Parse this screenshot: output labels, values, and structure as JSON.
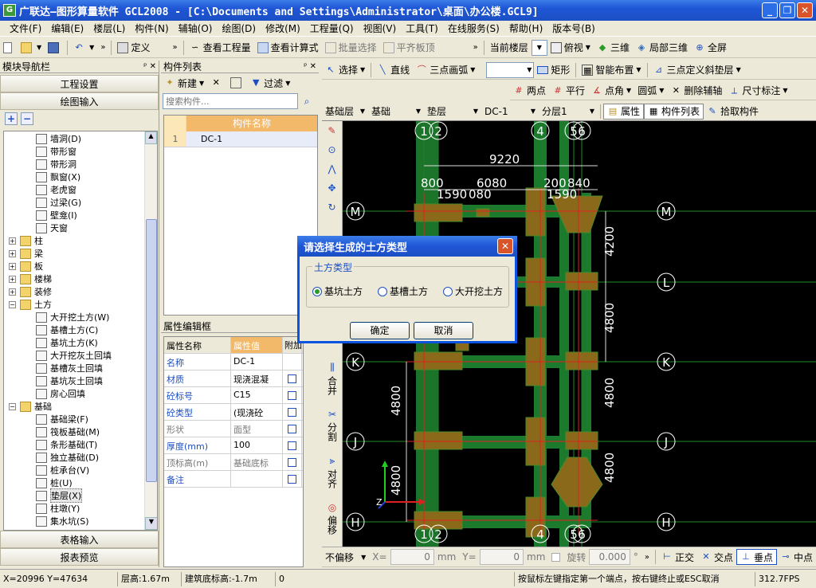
{
  "window": {
    "title": "广联达—图形算量软件 GCL2008 - [C:\\Documents and Settings\\Administrator\\桌面\\办公楼.GCL9]"
  },
  "menu": [
    "文件(F)",
    "编辑(E)",
    "楼层(L)",
    "构件(N)",
    "辅轴(O)",
    "绘图(D)",
    "修改(M)",
    "工程量(Q)",
    "视图(V)",
    "工具(T)",
    "在线服务(S)",
    "帮助(H)",
    "版本号(B)"
  ],
  "toolbar1": {
    "define": "定义",
    "view_quantity": "查看工程量",
    "view_formula": "查看计算式",
    "batch_select": "批量选择",
    "align_top": "平齐板顶",
    "current_floor_label": "当前楼层",
    "top_view": "俯视",
    "three_d": "三维",
    "local_3d": "局部三维",
    "full_screen": "全屏"
  },
  "toolbar2": {
    "select": "选择",
    "line": "直线",
    "arc3": "三点画弧",
    "rect": "矩形",
    "smart_layout": "智能布置",
    "three_pt_slope": "三点定义斜垫层"
  },
  "toolbar3": {
    "two_point": "两点",
    "parallel": "平行",
    "point_angle": "点角",
    "arc": "圆弧",
    "delete_aux": "删除辅轴",
    "dimension": "尺寸标注"
  },
  "toolbar4": {
    "layer_group": "基础层",
    "category": "基础",
    "type": "垫层",
    "member": "DC-1",
    "sublayer": "分层1",
    "attribute": "属性",
    "member_list": "构件列表",
    "pick_member": "拾取构件"
  },
  "nav_panel": {
    "title": "模块导航栏",
    "project_settings": "工程设置",
    "drawing_input": "绘图输入",
    "table_input": "表格输入",
    "report_preview": "报表预览",
    "tree": [
      {
        "label": "墙洞(D)",
        "level": 2,
        "type": "item"
      },
      {
        "label": "带形窗",
        "level": 2,
        "type": "item"
      },
      {
        "label": "带形洞",
        "level": 2,
        "type": "item"
      },
      {
        "label": "飘窗(X)",
        "level": 2,
        "type": "item"
      },
      {
        "label": "老虎窗",
        "level": 2,
        "type": "item"
      },
      {
        "label": "过梁(G)",
        "level": 2,
        "type": "item"
      },
      {
        "label": "壁龛(I)",
        "level": 2,
        "type": "item"
      },
      {
        "label": "天窗",
        "level": 2,
        "type": "item"
      },
      {
        "label": "柱",
        "level": 1,
        "type": "folder",
        "sign": "+"
      },
      {
        "label": "梁",
        "level": 1,
        "type": "folder",
        "sign": "+"
      },
      {
        "label": "板",
        "level": 1,
        "type": "folder",
        "sign": "+"
      },
      {
        "label": "楼梯",
        "level": 1,
        "type": "folder",
        "sign": "+"
      },
      {
        "label": "装修",
        "level": 1,
        "type": "folder",
        "sign": "+"
      },
      {
        "label": "土方",
        "level": 1,
        "type": "folder",
        "sign": "−"
      },
      {
        "label": "大开挖土方(W)",
        "level": 2,
        "type": "item"
      },
      {
        "label": "基槽土方(C)",
        "level": 2,
        "type": "item"
      },
      {
        "label": "基坑土方(K)",
        "level": 2,
        "type": "item"
      },
      {
        "label": "大开挖灰土回填",
        "level": 2,
        "type": "item"
      },
      {
        "label": "基槽灰土回填",
        "level": 2,
        "type": "item"
      },
      {
        "label": "基坑灰土回填",
        "level": 2,
        "type": "item"
      },
      {
        "label": "房心回填",
        "level": 2,
        "type": "item"
      },
      {
        "label": "基础",
        "level": 1,
        "type": "folder",
        "sign": "−"
      },
      {
        "label": "基础梁(F)",
        "level": 2,
        "type": "item"
      },
      {
        "label": "筏板基础(M)",
        "level": 2,
        "type": "item"
      },
      {
        "label": "条形基础(T)",
        "level": 2,
        "type": "item"
      },
      {
        "label": "独立基础(D)",
        "level": 2,
        "type": "item"
      },
      {
        "label": "桩承台(V)",
        "level": 2,
        "type": "item"
      },
      {
        "label": "桩(U)",
        "level": 2,
        "type": "item"
      },
      {
        "label": "垫层(X)",
        "level": 2,
        "type": "item",
        "selected": true
      },
      {
        "label": "柱墩(Y)",
        "level": 2,
        "type": "item"
      },
      {
        "label": "集水坑(S)",
        "level": 2,
        "type": "item"
      }
    ]
  },
  "component_list": {
    "title": "构件列表",
    "new": "新建",
    "filter": "过滤",
    "search_placeholder": "搜索构件...",
    "column": "构件名称",
    "rows": [
      {
        "index": "1",
        "name": "DC-1"
      }
    ]
  },
  "property_panel": {
    "title": "属性编辑框",
    "headers": [
      "属性名称",
      "属性值",
      "附加"
    ],
    "rows": [
      {
        "name": "名称",
        "value": "DC-1",
        "blue": true,
        "check": false
      },
      {
        "name": "材质",
        "value": "现浇混凝",
        "blue": true,
        "check": true
      },
      {
        "name": "砼标号",
        "value": "C15",
        "blue": true,
        "check": true
      },
      {
        "name": "砼类型",
        "value": "(现浇砼",
        "blue": true,
        "check": true
      },
      {
        "name": "形状",
        "value": "面型",
        "blue": false,
        "check": true
      },
      {
        "name": "厚度(mm)",
        "value": "100",
        "blue": true,
        "check": true
      },
      {
        "name": "顶标高(m)",
        "value": "基础底标",
        "blue": false,
        "check": true
      },
      {
        "name": "备注",
        "value": "",
        "blue": true,
        "check": true
      }
    ]
  },
  "side_tools": [
    "合并",
    "分割",
    "对齐",
    "偏移"
  ],
  "dialog": {
    "title": "请选择生成的土方类型",
    "group": "土方类型",
    "options": [
      "基坑土方",
      "基槽土方",
      "大开挖土方"
    ],
    "selected": 0,
    "ok": "确定",
    "cancel": "取消"
  },
  "canvas": {
    "axes_top": [
      "1",
      "2",
      "4",
      "5",
      "6"
    ],
    "axes_bottom": [
      "1",
      "2",
      "4",
      "5",
      "6"
    ],
    "axes_right": [
      "M",
      "L",
      "K",
      "J",
      "H"
    ],
    "axes_left": [
      "M",
      "K",
      "J",
      "H"
    ],
    "dims": [
      "9220",
      "800",
      "6080",
      "200",
      "840",
      "1590",
      "1590",
      "080",
      "4200",
      "4800",
      "4800",
      "4800",
      "4800",
      "4800"
    ]
  },
  "bottom_bar": {
    "offset_mode": "不偏移",
    "x_label": "X=",
    "x_value": "0",
    "y_label": "Y=",
    "y_value": "0",
    "unit": "mm",
    "rotate_label": "旋转",
    "rotate_value": "0.000",
    "degree": "°",
    "ortho": "正交",
    "intersection": "交点",
    "perp": "垂点",
    "mid": "中点"
  },
  "status": {
    "coords": "X=20996 Y=47634",
    "floor_height": "层高:1.67m",
    "bottom_elev": "建筑底标高:-1.7m",
    "zero": "0",
    "hint": "按鼠标左键指定第一个端点，按右键终止或ESC取消",
    "fps": "312.7FPS"
  }
}
